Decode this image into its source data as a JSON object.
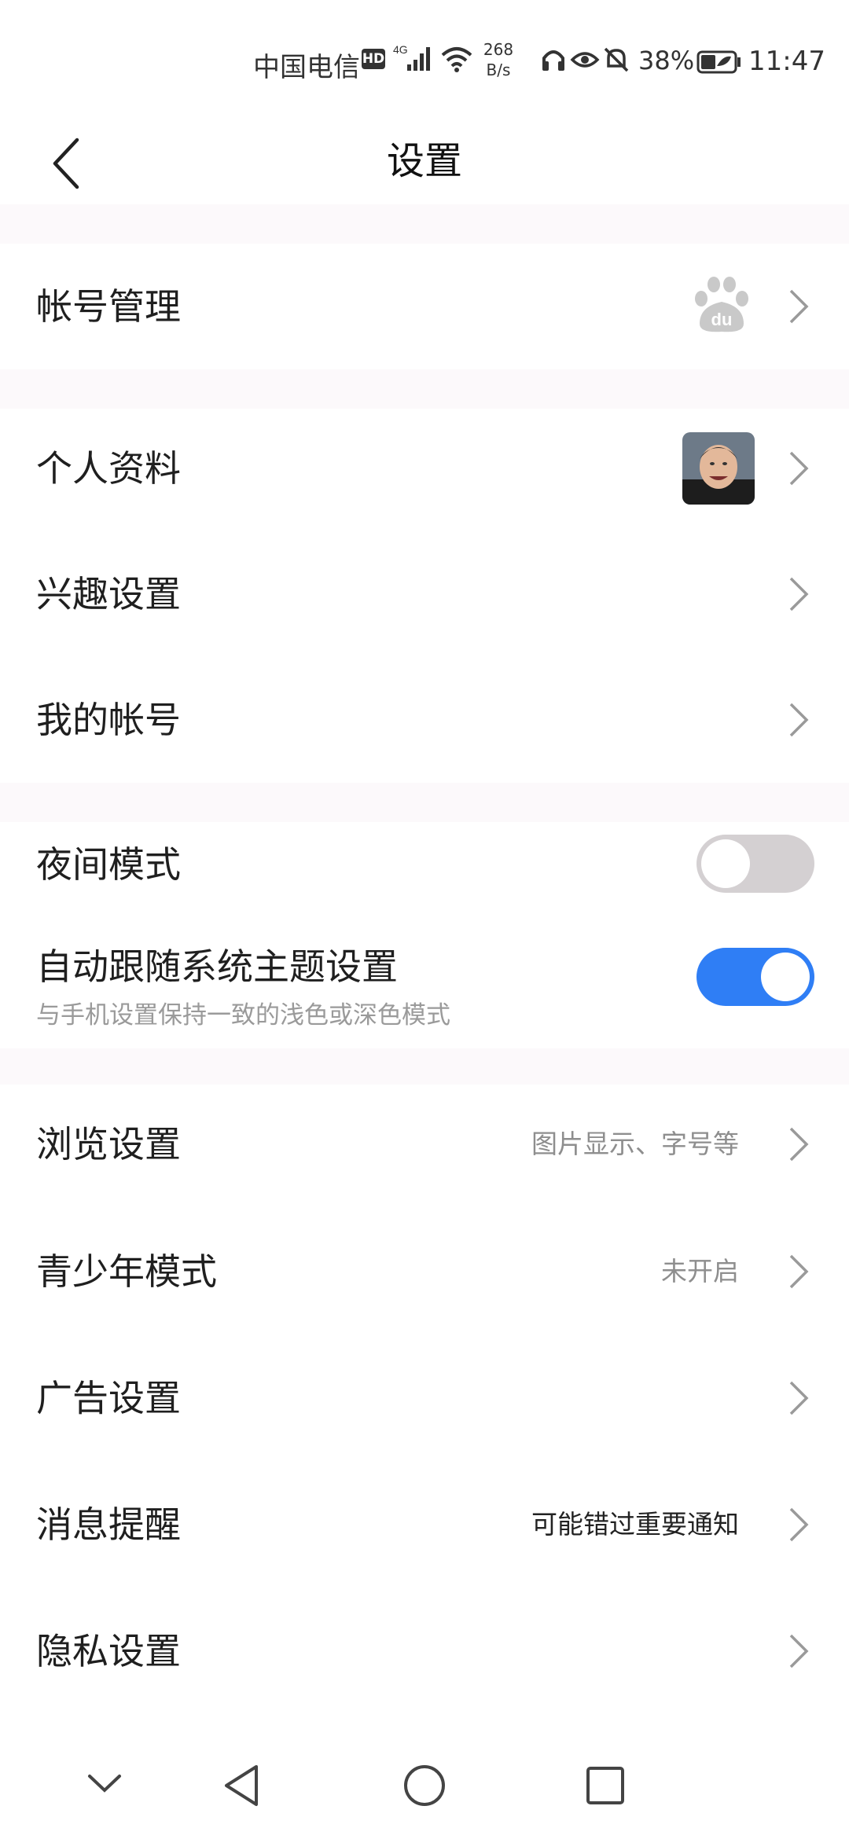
{
  "status_bar": {
    "carrier": "中国电信",
    "hd": "HD",
    "network": "4G",
    "speed_value": "268",
    "speed_unit": "B/s",
    "battery": "38%",
    "time": "11:47"
  },
  "header": {
    "title": "设置"
  },
  "sections": {
    "account_manage": {
      "label": "帐号管理",
      "logo_text": "du"
    },
    "profile": {
      "label": "个人资料"
    },
    "interests": {
      "label": "兴趣设置"
    },
    "my_account": {
      "label": "我的帐号"
    },
    "night_mode": {
      "label": "夜间模式",
      "enabled": false
    },
    "follow_system": {
      "label": "自动跟随系统主题设置",
      "sublabel": "与手机设置保持一致的浅色或深色模式",
      "enabled": true
    },
    "browse": {
      "label": "浏览设置",
      "value": "图片显示、字号等"
    },
    "teen_mode": {
      "label": "青少年模式",
      "value": "未开启"
    },
    "ads": {
      "label": "广告设置"
    },
    "notifications": {
      "label": "消息提醒",
      "value": "可能错过重要通知"
    },
    "privacy": {
      "label": "隐私设置"
    }
  },
  "colors": {
    "accent": "#2f7ef5",
    "toggle_off": "#d4d0d2",
    "separator": "#fcf9fb"
  }
}
